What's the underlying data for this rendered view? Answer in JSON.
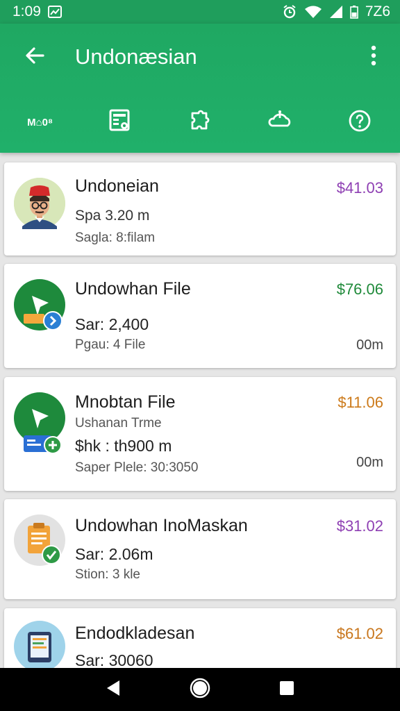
{
  "status": {
    "time": "1:09",
    "battery_text": "7Z6"
  },
  "app_bar": {
    "title": "Undonæsian"
  },
  "tabs": [
    {
      "name": "home",
      "label": "M⌂0⁸"
    },
    {
      "name": "files"
    },
    {
      "name": "puzzle"
    },
    {
      "name": "cloud"
    },
    {
      "name": "help"
    }
  ],
  "items": [
    {
      "title": "Undoneian",
      "line1": "Spa 3.20 m",
      "line2": "Sagla: 8:filam",
      "price": "$41.03",
      "price_color": "#8e3fb3"
    },
    {
      "title": "Undowhan File",
      "line1": "Sar: 2,400",
      "line2": "Pgau: 4 File",
      "price": "$76.06",
      "price_color": "#1f8a3a",
      "duration": "00m"
    },
    {
      "title": "Mnobtan File",
      "subtitle": "Ushanan Trme",
      "line1": "$hk : th900 m",
      "line2": "Saper Plele: 30:3050",
      "price": "$11.06",
      "price_color": "#cc7a1a",
      "duration": "00m"
    },
    {
      "title": "Undowhan InoMaskan",
      "line1": "Sar: 2.06m",
      "line2": "Stion: 3 kle",
      "price": "$31.02",
      "price_color": "#8e3fb3"
    },
    {
      "title": "Endodkladesan",
      "line1": "Sar: 30060",
      "price": "$61.02",
      "price_color": "#c8761c"
    }
  ],
  "icons": {
    "back": "arrow-left-icon",
    "overflow": "more-vert-icon",
    "nav_back": "triangle-back-icon",
    "nav_home": "circle-home-icon",
    "nav_recents": "square-recents-icon"
  }
}
